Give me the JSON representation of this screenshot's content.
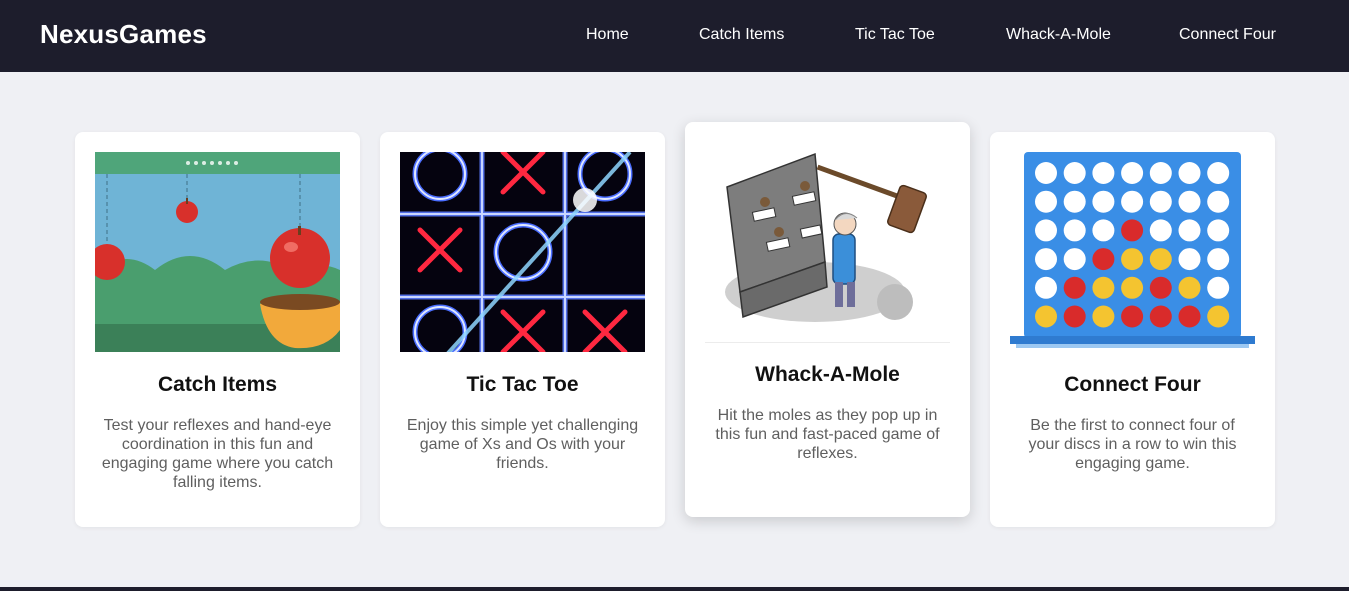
{
  "nav": {
    "brand": "NexusGames",
    "links": [
      "Home",
      "Catch Items",
      "Tic Tac Toe",
      "Whack-A-Mole",
      "Connect Four"
    ]
  },
  "cards": [
    {
      "title": "Catch Items",
      "description": "Test your reflexes and hand-eye coordination in this fun and engaging game where you catch falling items.",
      "image": "catch-items-game-illustration"
    },
    {
      "title": "Tic Tac Toe",
      "description": "Enjoy this simple yet challenging game of Xs and Os with your friends.",
      "image": "neon-tic-tac-toe-illustration"
    },
    {
      "title": "Whack-A-Mole",
      "description": "Hit the moles as they pop up in this fun and fast-paced game of reflexes.",
      "image": "whack-a-mole-cartoon-illustration"
    },
    {
      "title": "Connect Four",
      "description": "Be the first to connect four of your discs in a row to win this engaging game.",
      "image": "connect-four-board-illustration"
    }
  ],
  "colors": {
    "nav_background": "#1d1d2c",
    "page_background": "#eff0f4",
    "card_background": "#ffffff"
  }
}
